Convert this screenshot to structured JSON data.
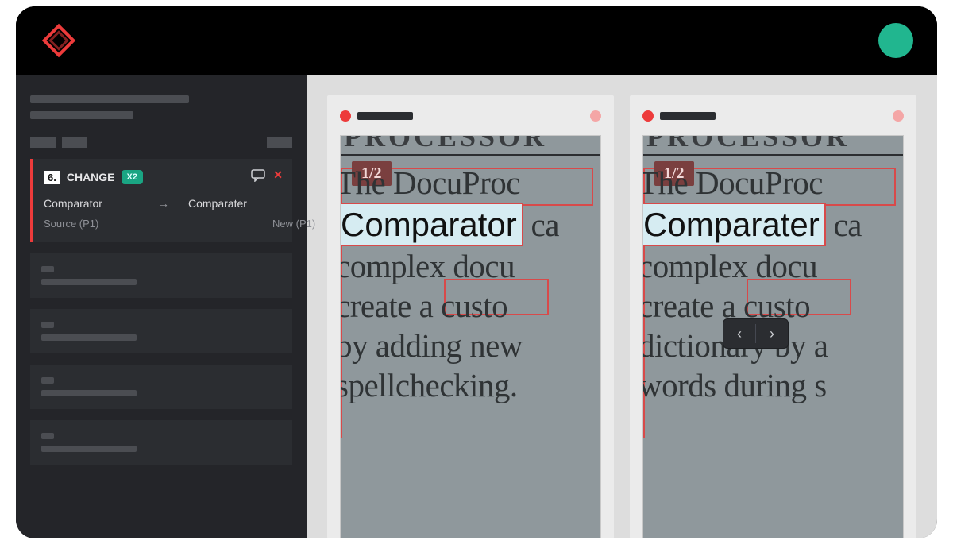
{
  "diff_card": {
    "number": "6.",
    "type_label": "CHANGE",
    "badge": "X2",
    "source_word": "Comparator",
    "new_word": "Comparater",
    "source_meta": "Source (P1)",
    "new_meta": "New (P1)"
  },
  "panes": {
    "left": {
      "page_badge": "1/2",
      "highlight": "Comparator",
      "lines": {
        "l1_pre": "The",
        "l1_post": " DocuProc",
        "l2_post": " ca",
        "l3": "complex docu",
        "l4": "create a custo",
        "l5": "by adding new",
        "l6": "spellchecking."
      }
    },
    "right": {
      "page_badge": "1/2",
      "highlight": "Comparater",
      "lines": {
        "l1_pre": "The",
        "l1_post": " DocuProc",
        "l2_post": " ca",
        "l3": "complex docu",
        "l4": "create a custo",
        "l5": "dictionary by a",
        "l6": "words during s"
      }
    }
  },
  "colors": {
    "accent_red": "#ed3b3b",
    "accent_green": "#21b68f"
  }
}
